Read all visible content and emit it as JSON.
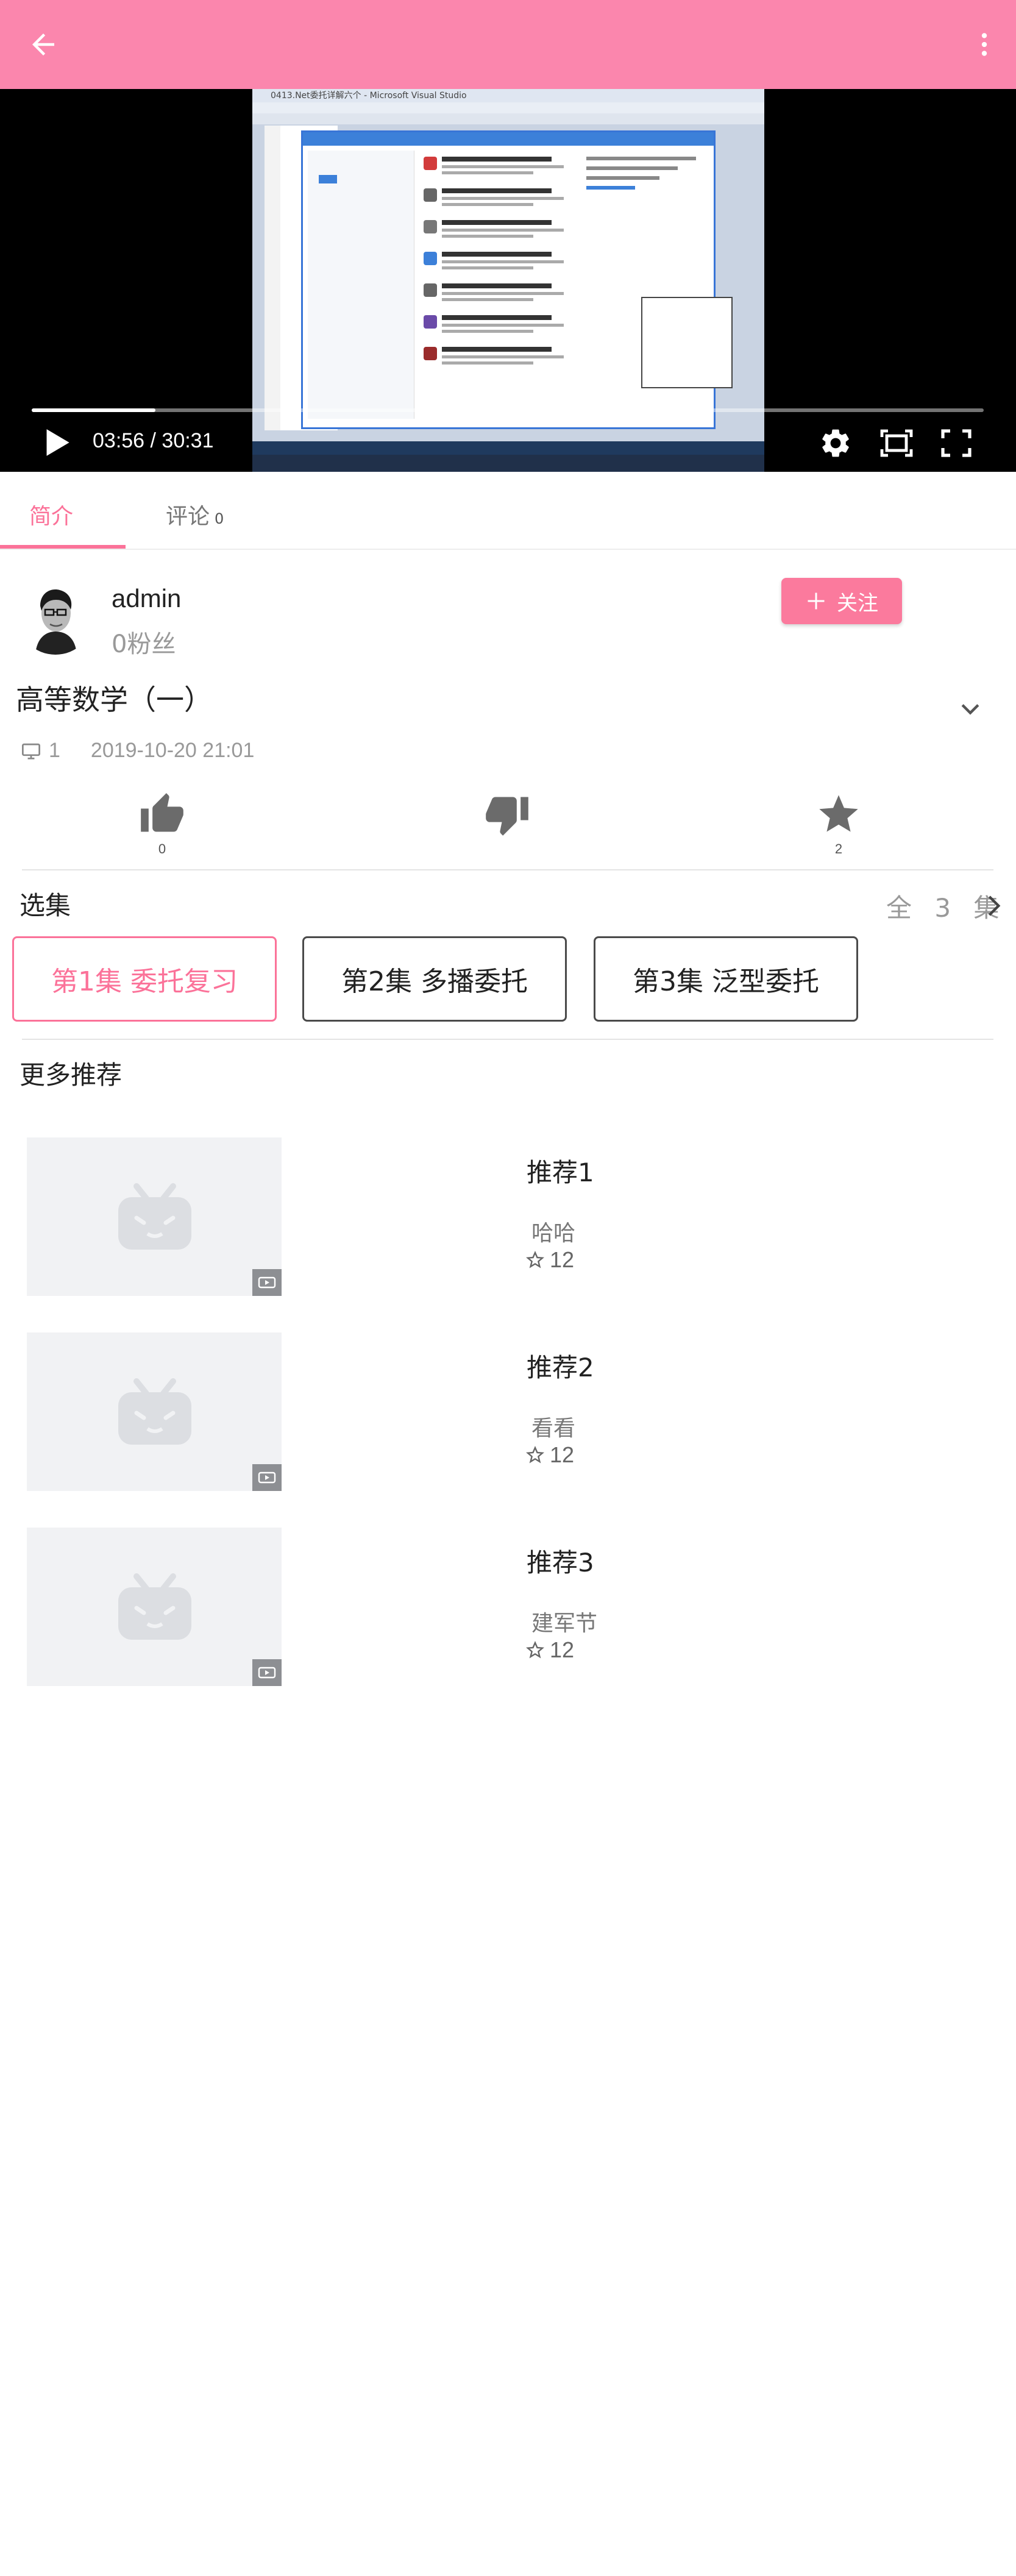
{
  "appbar": {
    "back_icon": "arrow-left-icon",
    "more_icon": "more-vertical-icon",
    "color": "#fb86ad"
  },
  "video": {
    "window_title": "0413.Net委托详解六个 - Microsoft Visual Studio",
    "time": "03:56 / 30:31",
    "progress": 0.13,
    "icons": [
      "play-icon",
      "gear-icon",
      "aspect-ratio-icon",
      "fullscreen-icon"
    ]
  },
  "tabs": [
    {
      "label": "简介",
      "count": ""
    },
    {
      "label": "评论",
      "count": "0"
    }
  ],
  "uploader": {
    "name": "admin",
    "fans": "0粉丝",
    "follow_label": "关注"
  },
  "video_info": {
    "title": "高等数学（一）",
    "views": "1",
    "date": "2019-10-20 21:01"
  },
  "actions": {
    "like_count": "0",
    "dislike_count": "",
    "favorite_count": "2"
  },
  "episodes": {
    "label": "选集",
    "count": "全 3 集",
    "items": [
      {
        "label": "第1集 委托复习",
        "active": true
      },
      {
        "label": "第2集 多播委托",
        "active": false
      },
      {
        "label": "第3集 泛型委托",
        "active": false
      }
    ]
  },
  "recommend": {
    "label": "更多推荐",
    "items": [
      {
        "title": "推荐1",
        "subtitle": "哈哈",
        "stars": "12"
      },
      {
        "title": "推荐2",
        "subtitle": "看看",
        "stars": "12"
      },
      {
        "title": "推荐3",
        "subtitle": "建军节",
        "stars": "12"
      }
    ]
  },
  "colors": {
    "accent": "#fb7299",
    "follow_bg": "#fb7a9d",
    "muted_text": "#999999"
  }
}
